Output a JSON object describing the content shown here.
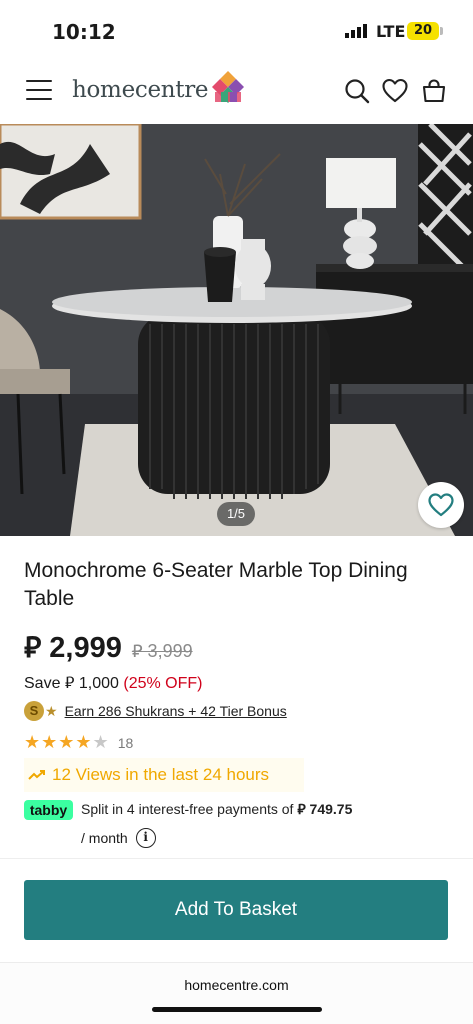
{
  "status_bar": {
    "time": "10:12",
    "network": "LTE",
    "battery": "20"
  },
  "header": {
    "logo_text": "homecentre",
    "icons": [
      "menu-icon",
      "search-icon",
      "heart-icon",
      "basket-icon"
    ]
  },
  "gallery": {
    "counter": "1/5"
  },
  "product": {
    "title": "Monochrome 6-Seater Marble Top Dining Table",
    "price": "⃃ 2,999",
    "old_price": "⃃ 3,999",
    "save_prefix": "Save ⃃ 1,000 ",
    "save_off": "(25% OFF)",
    "shukran_coin": "S",
    "shukran_text": "Earn 286 Shukrans + 42  Tier Bonus",
    "rating_count": "18",
    "rating": 4.5,
    "views_text": "12 Views in the last 24 hours",
    "tabby_badge": "tabby",
    "tabby_text": "Split in 4 interest-free payments of ",
    "tabby_amount": "⃃ 749.75",
    "tabby_month": "/ month",
    "info_symbol": "i"
  },
  "cta": {
    "add_to_basket": "Add To Basket"
  },
  "browser": {
    "url": "homecentre.com"
  },
  "colors": {
    "brand_teal": "#237e80",
    "discount_red": "#d0021b",
    "views_orange": "#f0a800",
    "tabby_green": "#3bffa1"
  }
}
